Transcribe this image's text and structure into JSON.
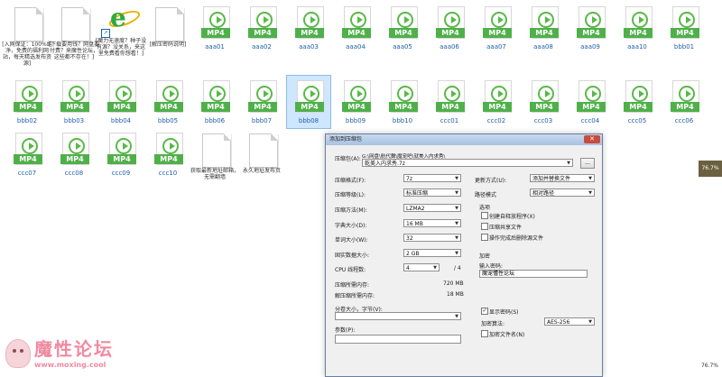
{
  "files_row1": [
    {
      "type": "doc",
      "caption": "[入网保证：100%纯净，免费的福利网站，每天精选发布资源]"
    },
    {
      "type": "doc",
      "caption": "[下载要用钱？网盘要付费？来魔性论坛，这些都不存在！]"
    },
    {
      "type": "ie",
      "caption": "[魔力无速度？种子没有源？没关系，来这里免费看你想看！]"
    },
    {
      "type": "doc",
      "caption": "[解压密码说明]"
    },
    {
      "type": "mp4",
      "name": "aaa01"
    },
    {
      "type": "mp4",
      "name": "aaa02"
    },
    {
      "type": "mp4",
      "name": "aaa03"
    },
    {
      "type": "mp4",
      "name": "aaa04"
    },
    {
      "type": "mp4",
      "name": "aaa05"
    },
    {
      "type": "mp4",
      "name": "aaa06"
    },
    {
      "type": "mp4",
      "name": "aaa07"
    },
    {
      "type": "mp4",
      "name": "aaa08"
    },
    {
      "type": "mp4",
      "name": "aaa09"
    },
    {
      "type": "mp4",
      "name": "aaa10"
    },
    {
      "type": "mp4",
      "name": "bbb01"
    }
  ],
  "files_row2": [
    "bbb02",
    "bbb03",
    "bbb04",
    "bbb05",
    "bbb06",
    "bbb07",
    "bbb08",
    "bbb09",
    "bbb10",
    "ccc01",
    "ccc02",
    "ccc03",
    "ccc04",
    "ccc05",
    "ccc06"
  ],
  "files_row3": [
    {
      "type": "mp4",
      "name": "ccc07"
    },
    {
      "type": "mp4",
      "name": "ccc08"
    },
    {
      "type": "mp4",
      "name": "ccc09"
    },
    {
      "type": "mp4",
      "name": "ccc10"
    },
    {
      "type": "doc",
      "caption": "获取最新地址邮箱，无需翻墙"
    },
    {
      "type": "doc",
      "caption": "永久地址发布页"
    }
  ],
  "mp4_badge": "MP4",
  "selected_file": "bbb08",
  "dialog": {
    "title": "添加到压缩包",
    "close": "✕",
    "archive_label": "压缩包(A):",
    "archive_path": "G:\\网盘\\航代舞\\魔宠吧\\就美入内求秀\\",
    "archive_name": "乾美入内求秀.7z",
    "browse": "...",
    "format_label": "压缩格式(F):",
    "format": "7z",
    "level_label": "压缩等级(L):",
    "level": "标准压缩",
    "method_label": "压缩方法(M):",
    "method": "LZMA2",
    "dict_label": "字典大小(D):",
    "dict": "16 MB",
    "word_label": "单词大小(W):",
    "word": "32",
    "solid_label": "固实数据大小:",
    "solid": "2 GB",
    "threads_label": "CPU 线程数:",
    "threads": "4",
    "threads_total": "/ 4",
    "mem_comp_label": "压缩所需内存:",
    "mem_comp": "720 MB",
    "mem_decomp_label": "解压缩所需内存:",
    "mem_decomp": "18 MB",
    "split_label": "分卷大小，字节(V):",
    "params_label": "参数(P):",
    "update_label": "更新方式(U):",
    "update": "添加并替换文件",
    "path_label": "路径模式",
    "path": "相对路径",
    "options_label": "选项",
    "opt_sfx": "创建自释放程序(X)",
    "opt_shared": "压缩共享文件",
    "opt_delete": "操作完成后删除源文件",
    "encrypt_label": "加密",
    "password_label": "输入密码:",
    "password": "魔宠懂性论坛",
    "show_pwd": "显示密码(S)",
    "enc_method_label": "加密算法:",
    "enc_method": "AES-256",
    "enc_names": "加密文件名(N)"
  },
  "side_badge": "76.7%",
  "zoom_text": "76.7%",
  "watermark": {
    "brand": "魔性论坛",
    "url": "www.moxing.cool"
  }
}
